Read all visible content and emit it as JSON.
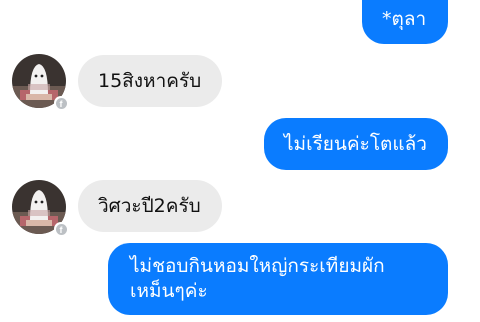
{
  "messages": [
    {
      "id": "m1",
      "direction": "outgoing",
      "text": "*ตุลา"
    },
    {
      "id": "m2",
      "direction": "incoming",
      "text": "15สิงหาครับ"
    },
    {
      "id": "m3",
      "direction": "outgoing",
      "text": "ไม่เรียนค่ะโตแล้ว"
    },
    {
      "id": "m4",
      "direction": "incoming",
      "text": "วิศวะปี2ครับ"
    },
    {
      "id": "m5",
      "direction": "outgoing",
      "lines": [
        "ไม่ชอบกินหอมใหญ่กระเทียมผัก",
        "เหม็นๆค่ะ"
      ]
    }
  ],
  "badge_icon": "facebook-icon",
  "badge_glyph": "f",
  "colors": {
    "outgoing_bubble": "#0a7cff",
    "incoming_bubble": "#ebebeb",
    "background": "#ffffff"
  }
}
